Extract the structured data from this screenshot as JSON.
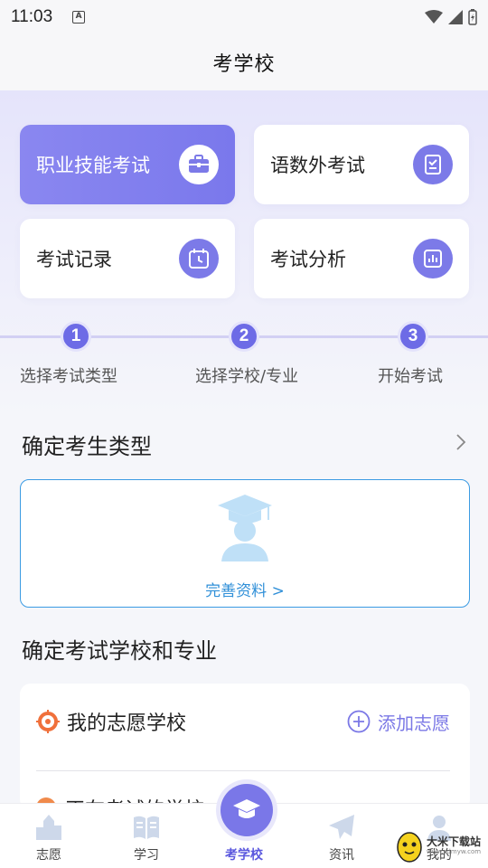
{
  "status_bar": {
    "time": "11:03"
  },
  "header": {
    "title": "考学校"
  },
  "cards": [
    {
      "label": "职业技能考试",
      "icon": "briefcase-icon"
    },
    {
      "label": "语数外考试",
      "icon": "clipboard-check-icon"
    },
    {
      "label": "考试记录",
      "icon": "clock-calendar-icon"
    },
    {
      "label": "考试分析",
      "icon": "bar-chart-icon"
    }
  ],
  "steps": [
    {
      "num": "1",
      "label": "选择考试类型"
    },
    {
      "num": "2",
      "label": "选择学校/专业"
    },
    {
      "num": "3",
      "label": "开始考试"
    }
  ],
  "candidate_section": {
    "title": "确定考生类型",
    "link": "完善资料 >"
  },
  "school_section": {
    "title": "确定考试学校和专业",
    "my_school": "我的志愿学校",
    "add_label": "添加志愿",
    "second_row": "正在考试的学校"
  },
  "tabs": [
    {
      "label": "志愿",
      "icon": "building-icon"
    },
    {
      "label": "学习",
      "icon": "book-icon"
    },
    {
      "label": "考学校",
      "icon": "graduation-cap-icon"
    },
    {
      "label": "资讯",
      "icon": "paper-plane-icon"
    },
    {
      "label": "我的",
      "icon": "person-icon"
    }
  ],
  "watermark": {
    "text": "大米下载站",
    "url": "www.zdmyw.com"
  },
  "colors": {
    "accent": "#7a77e8",
    "link": "#2f8fd8",
    "orange": "#f0703b"
  }
}
